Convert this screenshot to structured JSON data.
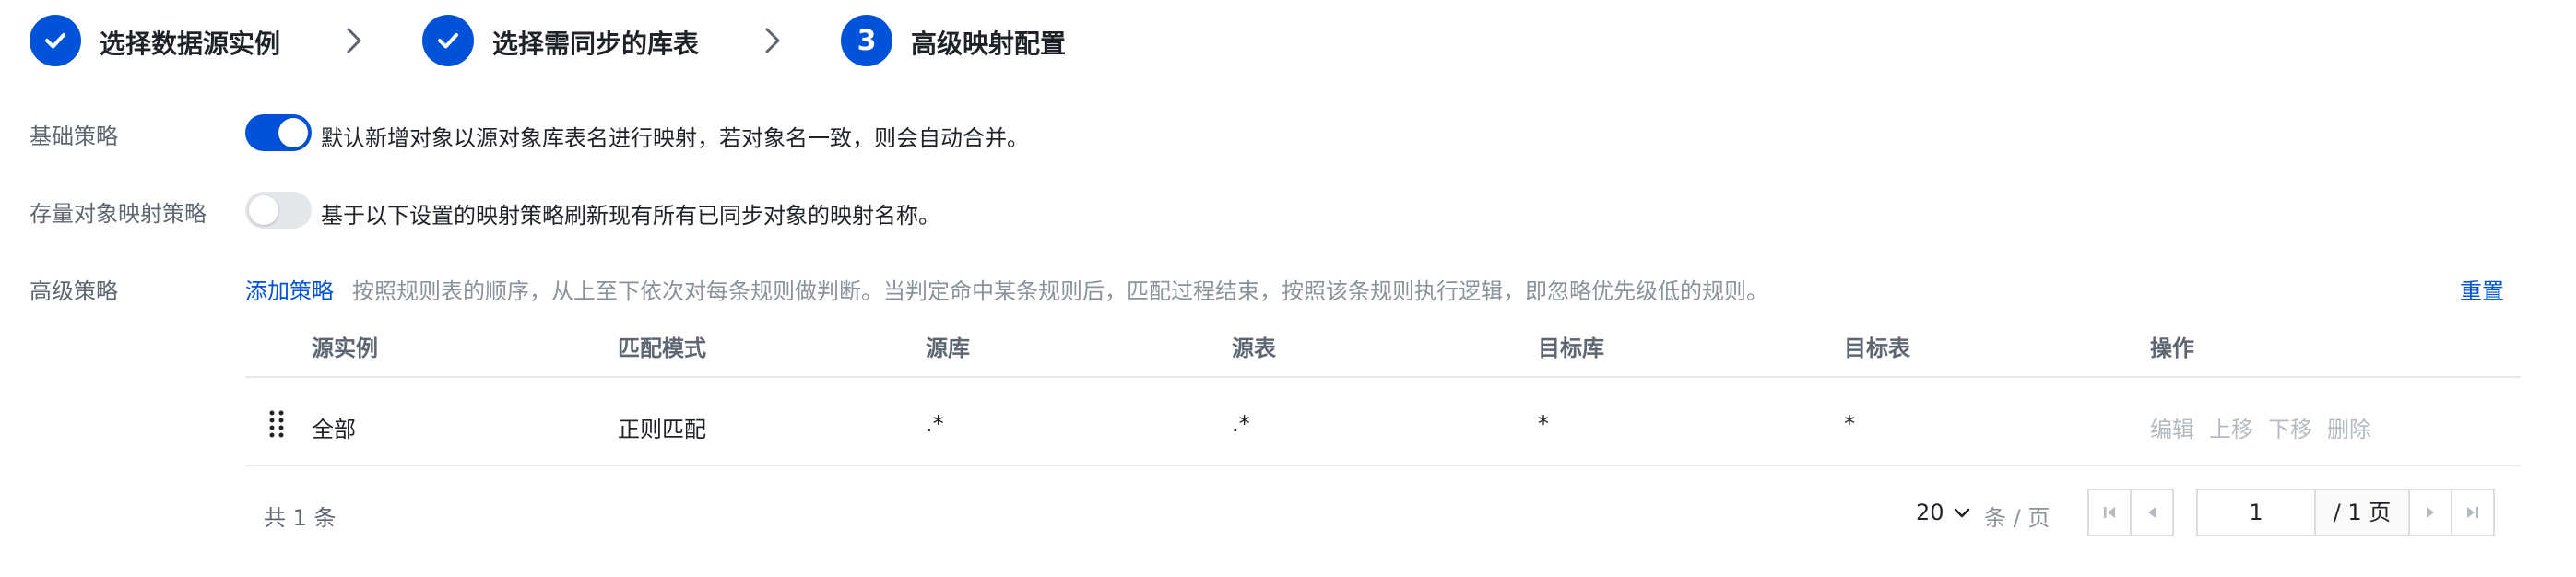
{
  "steps": [
    {
      "label": "选择数据源实例",
      "status": "done"
    },
    {
      "label": "选择需同步的库表",
      "status": "done"
    },
    {
      "label": "高级映射配置",
      "status": "current",
      "number": "3"
    }
  ],
  "basic": {
    "label": "基础策略",
    "enabled": true,
    "description": "默认新增对象以源对象库表名进行映射，若对象名一致，则会自动合并。"
  },
  "existing": {
    "label": "存量对象映射策略",
    "enabled": false,
    "description": "基于以下设置的映射策略刷新现有所有已同步对象的映射名称。"
  },
  "advanced": {
    "label": "高级策略",
    "add_label": "添加策略",
    "hint": "按照规则表的顺序，从上至下依次对每条规则做判断。当判定命中某条规则后，匹配过程结束，按照该条规则执行逻辑，即忽略优先级低的规则。",
    "reset_label": "重置"
  },
  "table": {
    "columns": [
      "源实例",
      "匹配模式",
      "源库",
      "源表",
      "目标库",
      "目标表",
      "操作"
    ],
    "rows": [
      {
        "source_instance": "全部",
        "match_mode": "正则匹配",
        "source_db": ".*",
        "source_table": ".*",
        "target_db": "*",
        "target_table": "*"
      }
    ],
    "actions": [
      "编辑",
      "上移",
      "下移",
      "删除"
    ]
  },
  "pagination": {
    "total_text": "共 1 条",
    "page_size": "20",
    "page_size_unit": "条 / 页",
    "current_page": "1",
    "total_pages_text": "/ 1 页"
  },
  "colors": {
    "primary": "#0052d9",
    "disabled_text": "#b5bac2",
    "hint_text": "#8b929c"
  }
}
